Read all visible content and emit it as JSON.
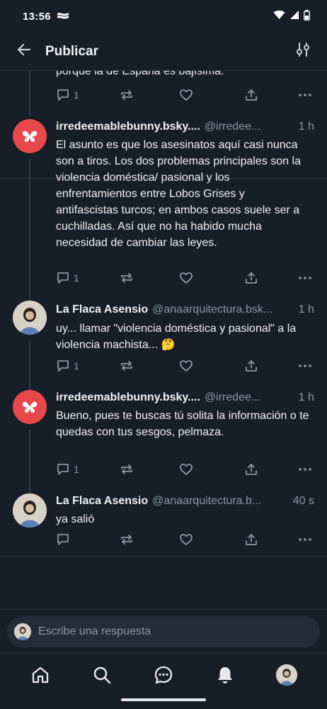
{
  "status_bar": {
    "time": "13:56"
  },
  "header": {
    "title": "Publicar"
  },
  "partial_post": {
    "text_tail": "porque la de España es bajísima.",
    "reply_count": "1"
  },
  "posts": [
    {
      "display_name": "irredeemablebunny.bsky....",
      "handle": "@irredee...",
      "time": "1 h",
      "text": "El asunto es que los asesinatos aquí casi nunca son a tiros. Los dos problemas principales son la violencia doméstica/ pasional y los enfrentamientos entre Lobos Grises y antifascistas turcos; en ambos casos suele ser a cuchilladas. Así que no ha habido mucha necesidad de cambiar las leyes.",
      "reply_count": "1"
    },
    {
      "display_name": "La Flaca Asensio",
      "handle": "@anaarquitectura.bsk...",
      "time": "1 h",
      "text": "uy... llamar \"violencia doméstica y pasional\" a la violencia machista... 🤔",
      "reply_count": "1"
    },
    {
      "display_name": "irredeemablebunny.bsky....",
      "handle": "@irredee...",
      "time": "1 h",
      "text": "Bueno, pues te buscas tú solita la información o te quedas con tus sesgos, pelmaza.",
      "reply_count": "1"
    },
    {
      "display_name": "La Flaca Asensio",
      "handle": "@anaarquitectura.b...",
      "time": "40 s",
      "text": "ya salió",
      "reply_count": ""
    }
  ],
  "composer": {
    "placeholder": "Escribe una respuesta"
  },
  "colors": {
    "background": "#161e27",
    "muted": "#8b97a6",
    "avatar_red": "#e8484a"
  },
  "icons": [
    "back-arrow-icon",
    "filter-icon",
    "reply-icon",
    "repost-icon",
    "like-icon",
    "share-icon",
    "more-icon",
    "home-icon",
    "search-icon",
    "chat-icon",
    "bell-icon"
  ]
}
